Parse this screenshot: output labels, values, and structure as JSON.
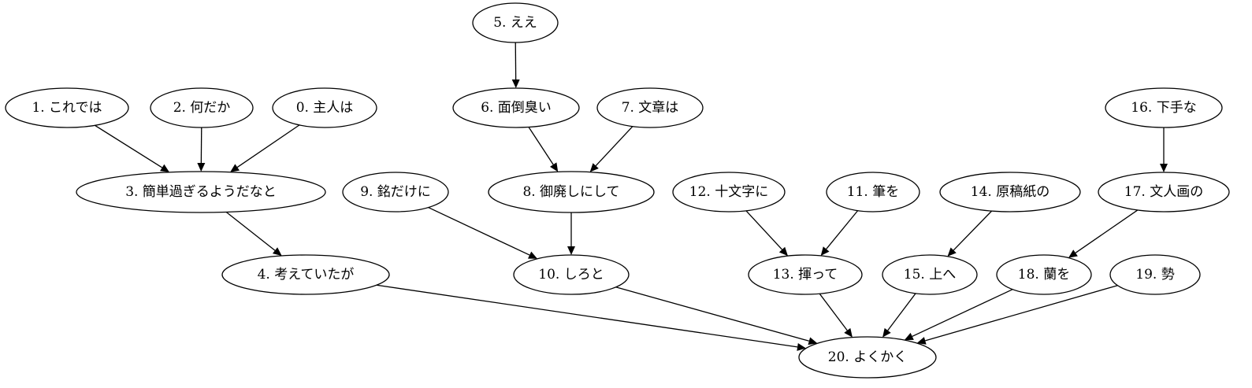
{
  "nodes": [
    {
      "id": "n0",
      "label": "0. 主人は"
    },
    {
      "id": "n1",
      "label": "1. これでは"
    },
    {
      "id": "n2",
      "label": "2. 何だか"
    },
    {
      "id": "n3",
      "label": "3. 簡単過ぎるようだなと"
    },
    {
      "id": "n4",
      "label": "4. 考えていたが"
    },
    {
      "id": "n5",
      "label": "5. ええ"
    },
    {
      "id": "n6",
      "label": "6. 面倒臭い"
    },
    {
      "id": "n7",
      "label": "7. 文章は"
    },
    {
      "id": "n8",
      "label": "8. 御廃しにして"
    },
    {
      "id": "n9",
      "label": "9. 銘だけに"
    },
    {
      "id": "n10",
      "label": "10. しろと"
    },
    {
      "id": "n11",
      "label": "11. 筆を"
    },
    {
      "id": "n12",
      "label": "12. 十文字に"
    },
    {
      "id": "n13",
      "label": "13. 揮って"
    },
    {
      "id": "n14",
      "label": "14. 原稿紙の"
    },
    {
      "id": "n15",
      "label": "15. 上へ"
    },
    {
      "id": "n16",
      "label": "16. 下手な"
    },
    {
      "id": "n17",
      "label": "17. 文人画の"
    },
    {
      "id": "n18",
      "label": "18. 蘭を"
    },
    {
      "id": "n19",
      "label": "19. 勢"
    },
    {
      "id": "n20",
      "label": "20. よくかく"
    }
  ],
  "edges": [
    {
      "from": "n1",
      "to": "n3"
    },
    {
      "from": "n2",
      "to": "n3"
    },
    {
      "from": "n0",
      "to": "n3"
    },
    {
      "from": "n3",
      "to": "n4"
    },
    {
      "from": "n5",
      "to": "n6"
    },
    {
      "from": "n6",
      "to": "n8"
    },
    {
      "from": "n7",
      "to": "n8"
    },
    {
      "from": "n9",
      "to": "n10"
    },
    {
      "from": "n8",
      "to": "n10"
    },
    {
      "from": "n12",
      "to": "n13"
    },
    {
      "from": "n11",
      "to": "n13"
    },
    {
      "from": "n14",
      "to": "n15"
    },
    {
      "from": "n16",
      "to": "n17"
    },
    {
      "from": "n17",
      "to": "n18"
    },
    {
      "from": "n4",
      "to": "n20"
    },
    {
      "from": "n10",
      "to": "n20"
    },
    {
      "from": "n13",
      "to": "n20"
    },
    {
      "from": "n15",
      "to": "n20"
    },
    {
      "from": "n18",
      "to": "n20"
    },
    {
      "from": "n19",
      "to": "n20"
    }
  ]
}
